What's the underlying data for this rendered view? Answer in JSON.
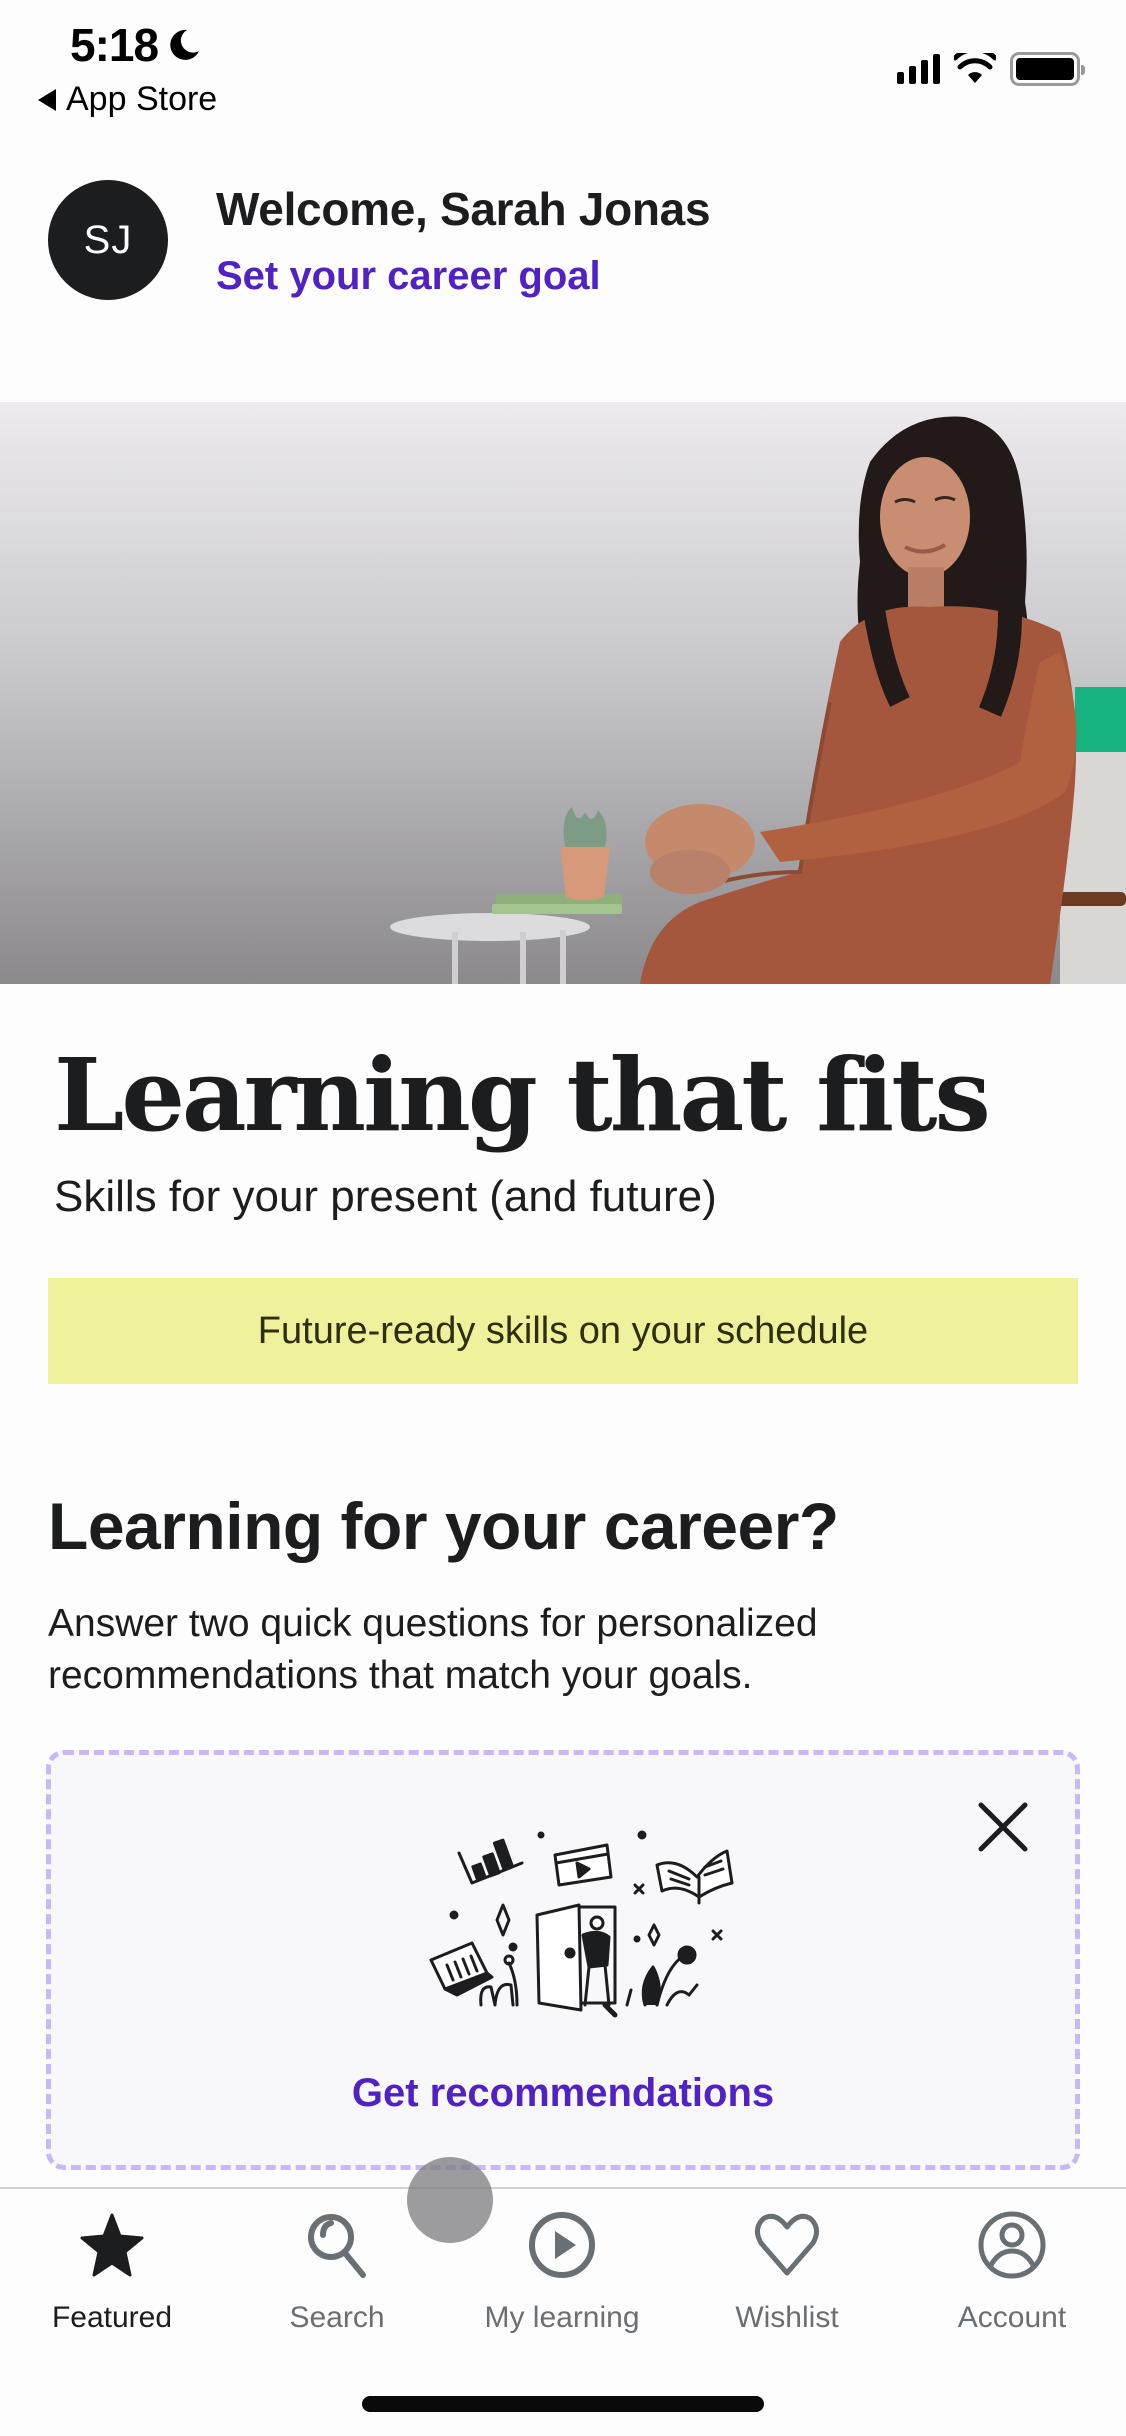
{
  "status_bar": {
    "time": "5:18",
    "focus_icon": "moon-icon",
    "back_app": "App Store",
    "icons": [
      "cellular-signal-icon",
      "wifi-icon",
      "battery-icon"
    ]
  },
  "header": {
    "avatar_initials": "SJ",
    "welcome": "Welcome, Sarah Jonas",
    "career_goal_link": "Set your career goal"
  },
  "hero": {
    "image": "woman-seated-on-chair-photo"
  },
  "intro": {
    "headline": "Learning that fits",
    "subheadline": "Skills for your present (and future)",
    "banner": "Future-ready skills on your schedule"
  },
  "career": {
    "heading": "Learning for your career?",
    "description": "Answer two quick questions for personalized recommendations that match your goals.",
    "card": {
      "illustration": "person-opening-door-illustration",
      "close_icon": "close-icon",
      "cta": "Get recommendations"
    }
  },
  "tab_bar": {
    "active": "Featured",
    "tabs": [
      {
        "label": "Featured",
        "icon": "star-icon"
      },
      {
        "label": "Search",
        "icon": "search-icon"
      },
      {
        "label": "My learning",
        "icon": "play-circle-icon"
      },
      {
        "label": "Wishlist",
        "icon": "heart-icon"
      },
      {
        "label": "Account",
        "icon": "account-icon"
      }
    ]
  },
  "colors": {
    "accent_purple": "#5022c3",
    "text_primary": "#1c1d1f",
    "banner_bg": "#eef29d",
    "card_border": "#c8b8f3",
    "tab_inactive": "#6a6f73"
  }
}
